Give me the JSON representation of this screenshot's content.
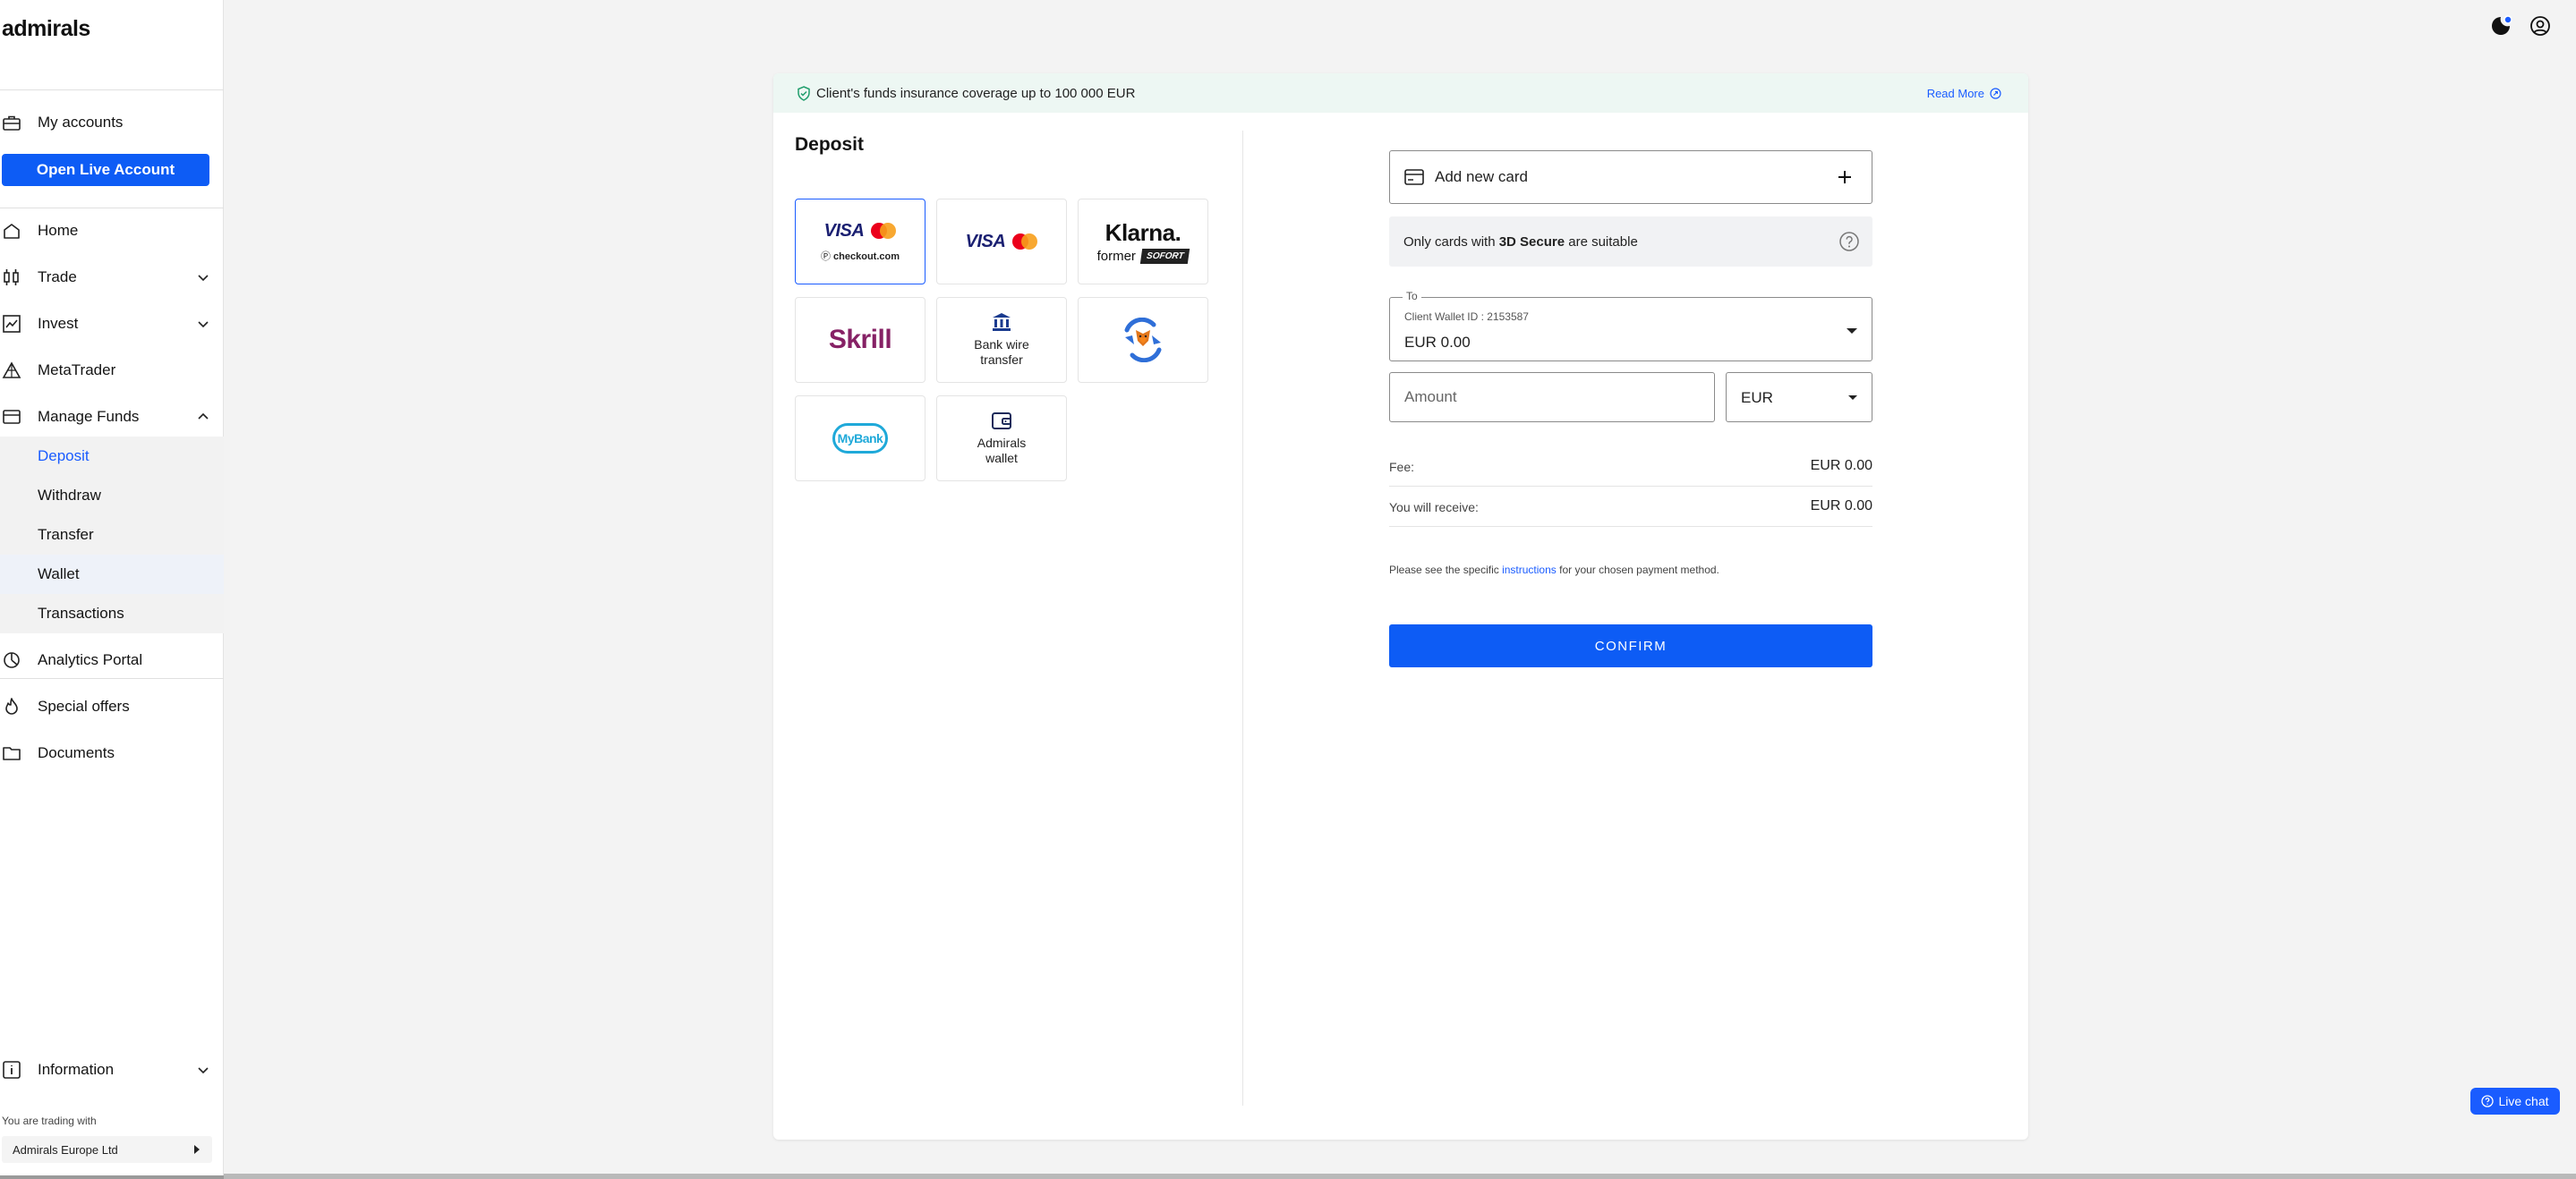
{
  "app": {
    "logo": "admirals"
  },
  "sidebar": {
    "my_accounts": "My accounts",
    "open_live_account": "Open Live Account",
    "items": [
      {
        "label": "Home",
        "icon": "home-icon"
      },
      {
        "label": "Trade",
        "icon": "candles-icon"
      },
      {
        "label": "Invest",
        "icon": "chart-line-icon"
      },
      {
        "label": "MetaTrader",
        "icon": "metatrader-icon"
      },
      {
        "label": "Manage Funds",
        "icon": "wallet-icon"
      }
    ],
    "manage_funds_sub": [
      "Deposit",
      "Withdraw",
      "Transfer",
      "Wallet",
      "Transactions"
    ],
    "items_after": [
      {
        "label": "Analytics Portal",
        "icon": "pie-chart-icon"
      },
      {
        "label": "Special offers",
        "icon": "flame-icon"
      },
      {
        "label": "Documents",
        "icon": "folder-icon"
      }
    ],
    "information": "Information",
    "trading_with": "You are trading with",
    "entity": "Admirals Europe Ltd"
  },
  "banner": {
    "text": "Client's funds insurance coverage up to 100 000 EUR",
    "read_more": "Read More"
  },
  "deposit": {
    "title": "Deposit",
    "methods": {
      "visa_label": "VISA",
      "checkout_label": "checkout.com",
      "klarna_label": "Klarna.",
      "klarna_former": "former",
      "sofort_label": "SOFORT",
      "skrill_label": "Skrill",
      "bank_wire_line1": "Bank wire",
      "bank_wire_line2": "transfer",
      "mybank_label": "MyBank",
      "admirals_wallet_line1": "Admirals",
      "admirals_wallet_line2": "wallet"
    }
  },
  "form": {
    "add_card": "Add new card",
    "secure_prefix": "Only cards with ",
    "secure_bold": "3D Secure",
    "secure_suffix": " are suitable",
    "to_legend": "To",
    "to_sub": "Client Wallet ID : 2153587",
    "to_value": "EUR 0.00",
    "amount_placeholder": "Amount",
    "currency": "EUR",
    "fee_label": "Fee:",
    "fee_value": "EUR 0.00",
    "receive_label": "You will receive:",
    "receive_value": "EUR 0.00",
    "note_prefix": "Please see the specific ",
    "note_link": "instructions",
    "note_suffix": " for your chosen payment method.",
    "confirm": "CONFIRM"
  },
  "live_chat": "Live chat",
  "colors": {
    "accent": "#0d5cf5",
    "banner_bg": "#edf7f3",
    "skrill": "#862165"
  }
}
